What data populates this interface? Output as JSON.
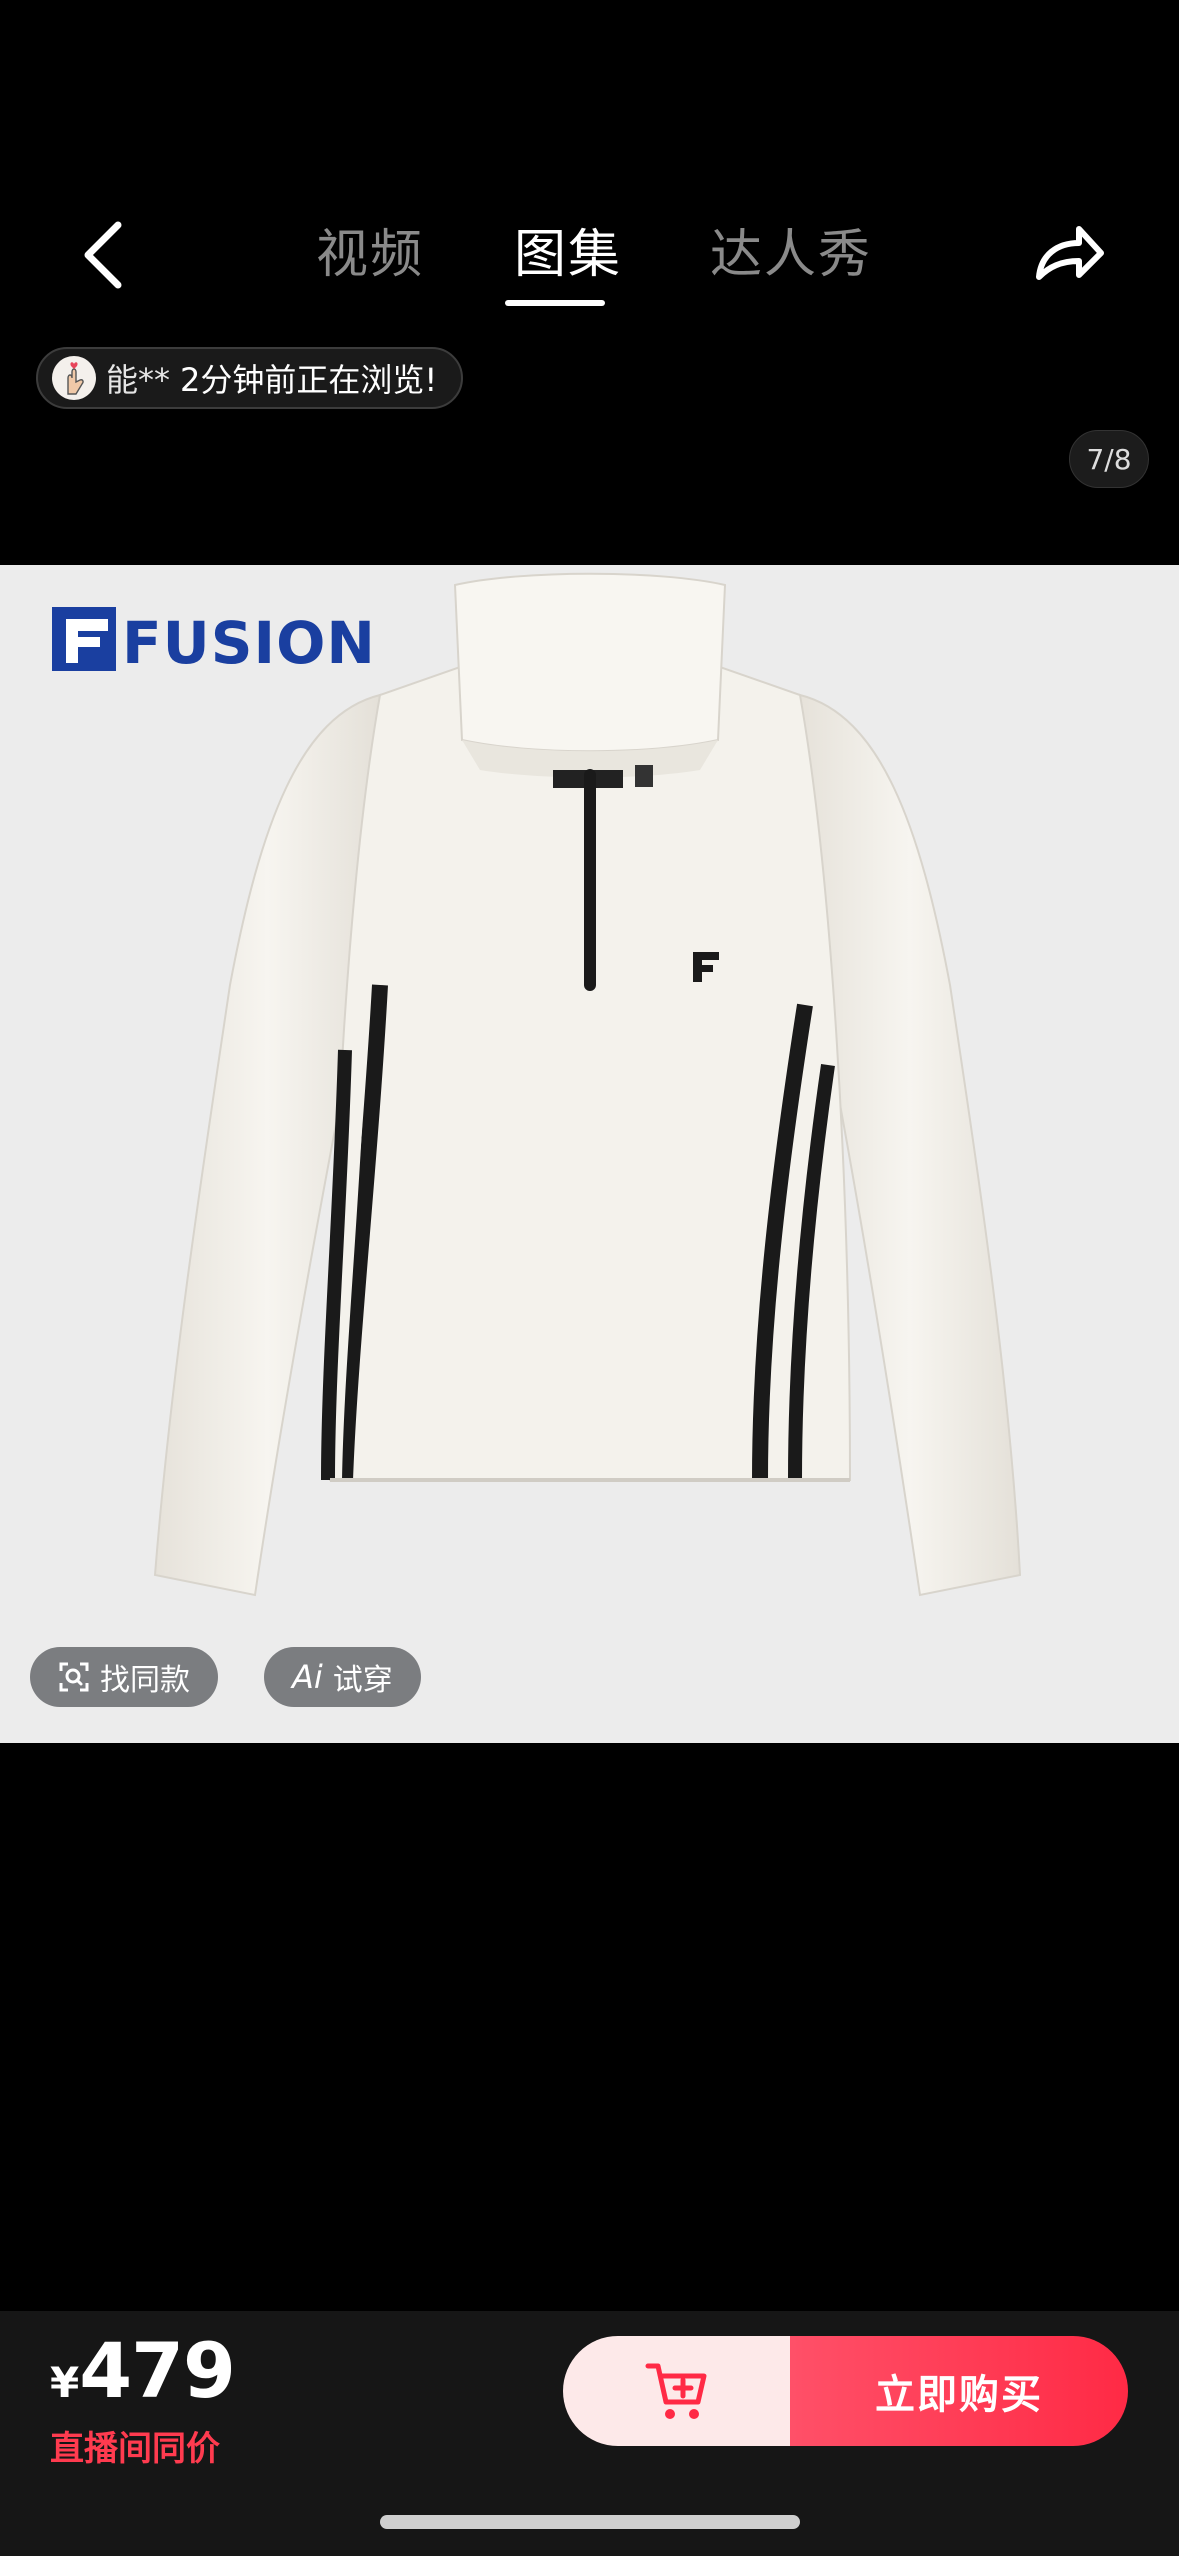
{
  "header": {
    "tabs": [
      {
        "label": "视频",
        "active": false
      },
      {
        "label": "图集",
        "active": true
      },
      {
        "label": "达人秀",
        "active": false
      }
    ],
    "back_icon": "chevron-left-icon",
    "share_icon": "share-arrow-icon"
  },
  "browse_notice": {
    "user": "能**",
    "text": "2分钟前正在浏览!"
  },
  "gallery": {
    "counter": "7/8",
    "brand_logo_text": "FUSION",
    "actions": {
      "find_similar": "找同款",
      "ai_tryon_prefix": "Ai",
      "ai_tryon": "试穿"
    }
  },
  "purchase": {
    "currency": "¥",
    "price": "479",
    "price_note": "直播间同价",
    "buy_label": "立即购买",
    "cart_icon": "cart-add-icon"
  },
  "colors": {
    "accent": "#ff2a45",
    "price_note": "#ff3b4f",
    "brand_blue": "#1a3fa0"
  }
}
